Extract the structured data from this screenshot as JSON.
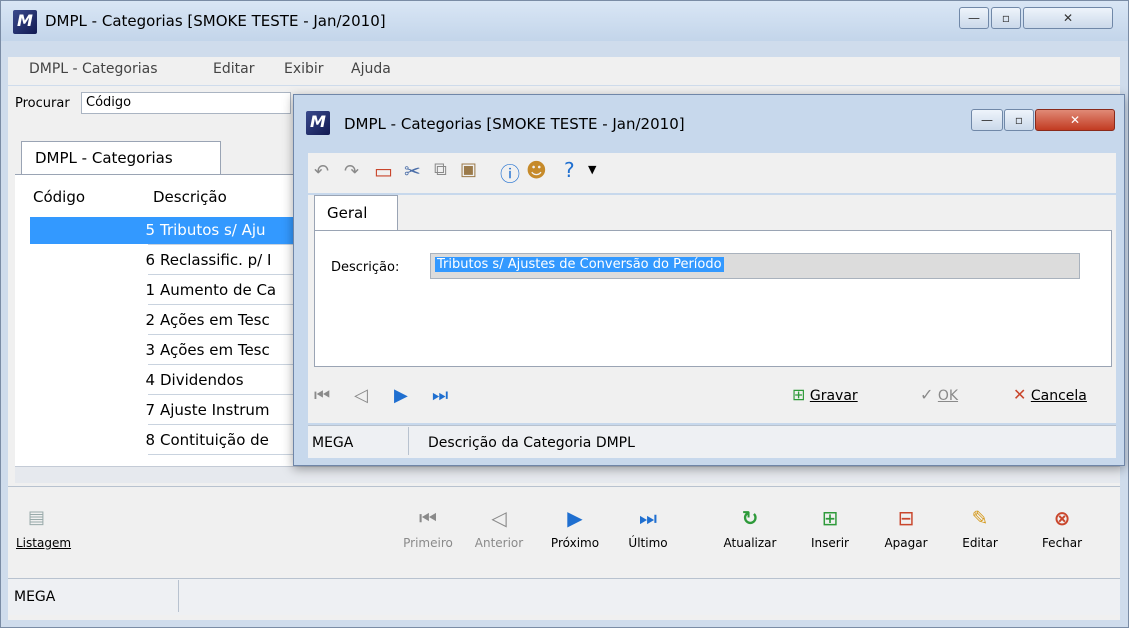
{
  "main": {
    "title": "DMPL - Categorias [SMOKE TESTE - Jan/2010]",
    "app_icon_letter": "M",
    "window_buttons": {
      "minimize": "—",
      "maximize": "▫",
      "close": "✕"
    },
    "menu": [
      "DMPL - Categorias",
      "Editar",
      "Exibir",
      "Ajuda"
    ],
    "search_label": "Procurar",
    "search_value": "Código",
    "tab_label": "DMPL - Categorias",
    "columns": {
      "code": "Código",
      "desc": "Descrição"
    },
    "rows": [
      {
        "code": "5",
        "desc": "Tributos s/ Aju"
      },
      {
        "code": "6",
        "desc": "Reclassific. p/ I"
      },
      {
        "code": "1",
        "desc": "Aumento de Ca"
      },
      {
        "code": "2",
        "desc": "Ações em Tesc"
      },
      {
        "code": "3",
        "desc": "Ações em Tesc"
      },
      {
        "code": "4",
        "desc": "Dividendos"
      },
      {
        "code": "7",
        "desc": "Ajuste Instrum"
      },
      {
        "code": "8",
        "desc": "Contituição de"
      }
    ],
    "toolbar": {
      "listagem": "Listagem",
      "primeiro": "Primeiro",
      "anterior": "Anterior",
      "proximo": "Próximo",
      "ultimo": "Último",
      "atualizar": "Atualizar",
      "inserir": "Inserir",
      "apagar": "Apagar",
      "editar": "Editar",
      "fechar": "Fechar"
    },
    "status": "MEGA"
  },
  "dialog": {
    "title": "DMPL - Categorias [SMOKE TESTE - Jan/2010]",
    "tab_label": "Geral",
    "field_label": "Descrição:",
    "field_value": "Tributos s/ Ajustes de Conversão do Período",
    "buttons": {
      "gravar": "Gravar",
      "ok": "OK",
      "cancela": "Cancela"
    },
    "status_left": "MEGA",
    "status_right": "Descrição da Categoria DMPL"
  },
  "colors": {
    "selection": "#3399ff",
    "accent_blue": "#1f6fd0",
    "close_red": "#c9462c"
  }
}
